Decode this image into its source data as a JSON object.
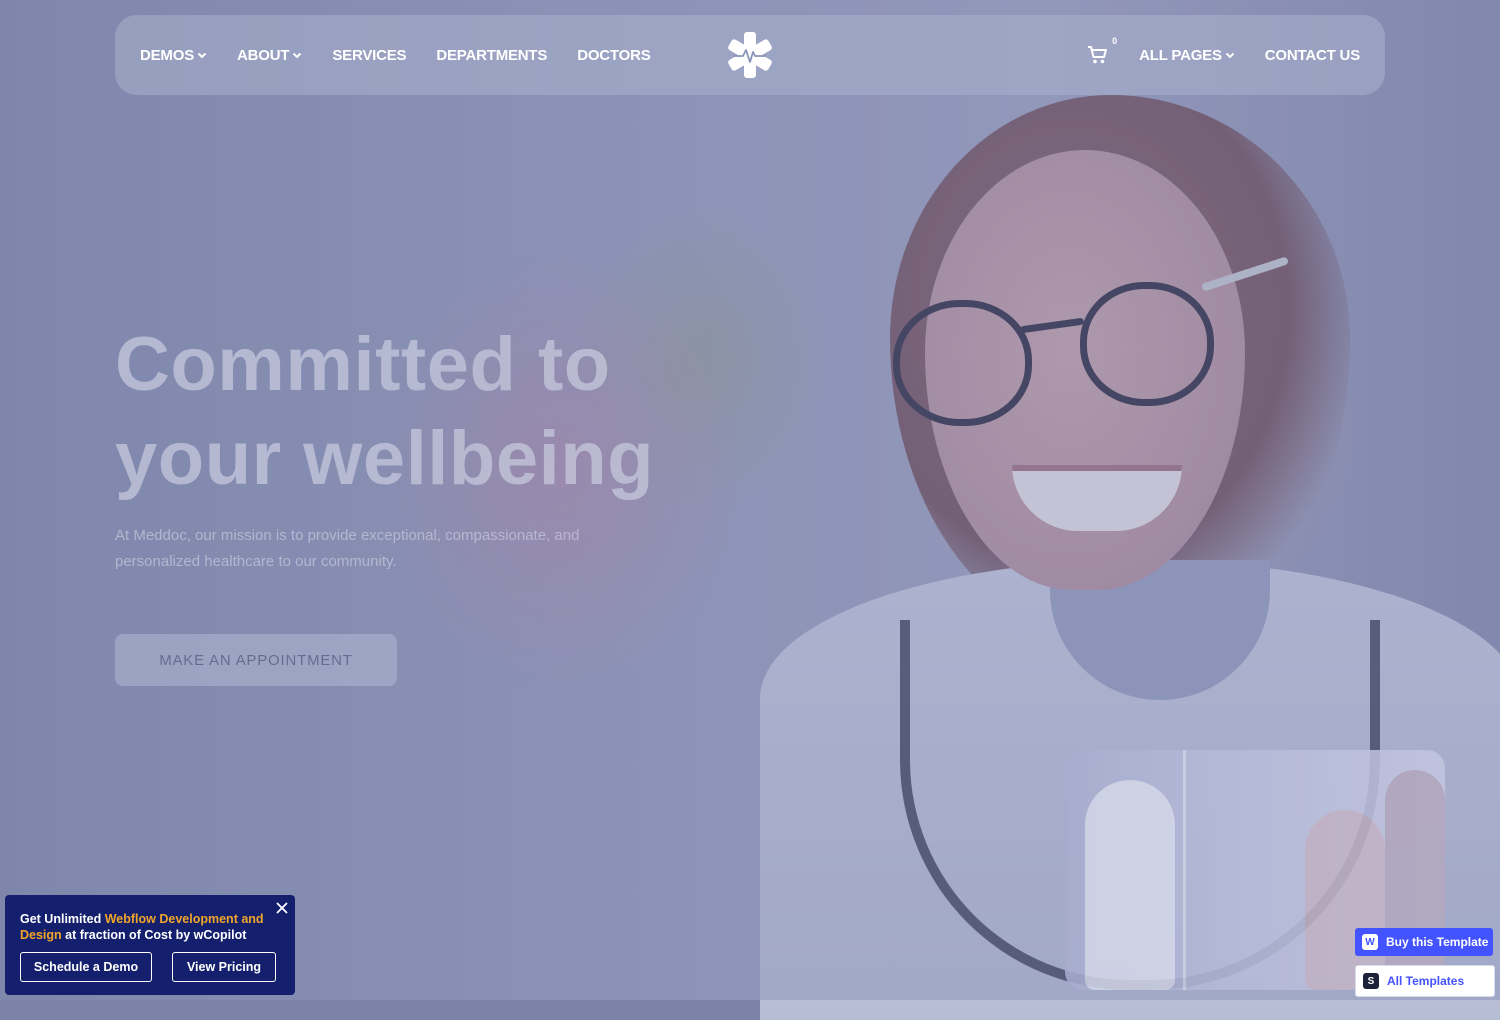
{
  "nav": {
    "left_items": [
      {
        "label": "DEMOS",
        "has_dropdown": true
      },
      {
        "label": "ABOUT",
        "has_dropdown": true
      },
      {
        "label": "SERVICES",
        "has_dropdown": false
      },
      {
        "label": "DEPARTMENTS",
        "has_dropdown": false
      },
      {
        "label": "DOCTORS",
        "has_dropdown": false
      }
    ],
    "logo_icon": "medical-star-heartbeat-icon",
    "cart_count": "0",
    "right_items": [
      {
        "label": "ALL PAGES",
        "has_dropdown": true
      },
      {
        "label": "CONTACT US",
        "has_dropdown": false
      }
    ]
  },
  "hero": {
    "title_line1": "Committed to",
    "title_line2": "your wellbeing",
    "subtitle": "At Meddoc, our mission is to provide exceptional, compassionate, and personalized healthcare to our community.",
    "cta_label": "MAKE AN APPOINTMENT"
  },
  "promo": {
    "text_prefix": "Get Unlimited ",
    "text_highlight": "Webflow Development and Design",
    "text_suffix": " at fraction of Cost by wCopilot",
    "schedule_label": "Schedule a Demo",
    "pricing_label": "View Pricing"
  },
  "badges": {
    "buy_label": "Buy this Template",
    "all_label": "All Templates"
  },
  "colors": {
    "promo_bg": "#14206e",
    "promo_highlight": "#f0a52a",
    "webflow_blue": "#4353ff"
  }
}
